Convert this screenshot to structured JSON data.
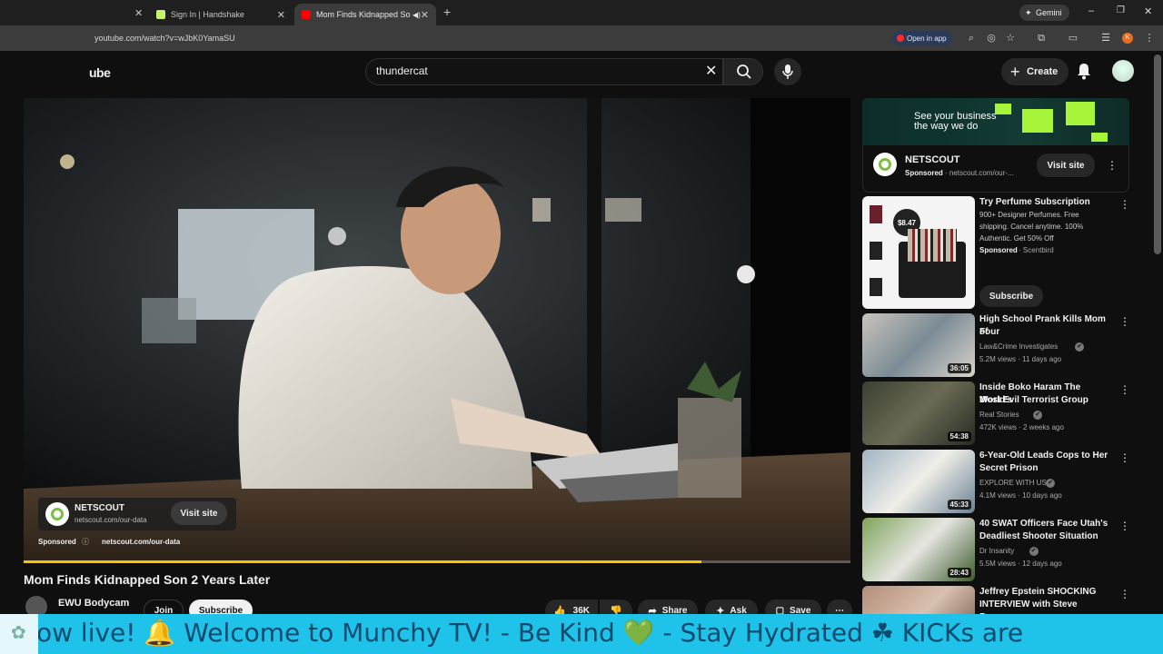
{
  "browser": {
    "tabs": [
      {
        "label": "Sign In | Handshake",
        "favicon_color": "#c7f26b"
      },
      {
        "label": "Mom Finds Kidnapped Son",
        "favicon_color": "#ff0000",
        "active": true
      }
    ],
    "url": "youtube.com/watch?v=wJbK0YamaSU",
    "gemini_label": "Gemini",
    "open_in_app_label": "Open in app"
  },
  "youtube": {
    "logo_text": "ube",
    "search_value": "thundercat",
    "create_label": "Create"
  },
  "player": {
    "progress_fraction": 0.82,
    "ad": {
      "brand": "NETSCOUT",
      "url": "netscout.com/our-data",
      "visit_label": "Visit site",
      "sponsored_label": "Sponsored",
      "sponsored_url": "netscout.com/our-data"
    }
  },
  "video": {
    "title": "Mom Finds Kidnapped Son 2 Years Later",
    "channel": "EWU Bodycam",
    "join_label": "Join",
    "subscribe_label": "Subscribe",
    "likes": "36K",
    "share_label": "Share",
    "ask_label": "Ask",
    "save_label": "Save"
  },
  "sidebar": {
    "ad_banner": {
      "headline_line1": "See your business",
      "headline_line2": "the way we do",
      "brand": "NETSCOUT",
      "sponsored": "Sponsored",
      "url": "· netscout.com/our-...",
      "visit_label": "Visit site"
    },
    "promo": {
      "title": "Try Perfume Subscription",
      "desc_line1": "900+ Designer Perfumes. Free",
      "desc_line2": "shipping. Cancel anytime. 100%",
      "desc_line3": "Authentic. Get 50% Off",
      "sponsored": "Sponsored",
      "advertiser": "· Scentbird",
      "subscribe_label": "Subscribe",
      "price_badge": "$8.47"
    },
    "videos": [
      {
        "title_line1": "High School Prank Kills Mom of",
        "title_line2": "Four",
        "channel": "Law&Crime Investigates",
        "meta": "5.2M views · 11 days ago",
        "duration": "36:05"
      },
      {
        "title_line1": "Inside Boko Haram The World's",
        "title_line2": "Most Evil Terrorist Group",
        "channel": "Real Stories",
        "meta": "472K views · 2 weeks ago",
        "duration": "54:38"
      },
      {
        "title_line1": "6-Year-Old Leads Cops to Her",
        "title_line2": "Secret Prison",
        "channel": "EXPLORE WITH US",
        "meta": "4.1M views · 10 days ago",
        "duration": "45:33"
      },
      {
        "title_line1": "40 SWAT Officers Face Utah's",
        "title_line2": "Deadliest Shooter Situation",
        "channel": "Dr Insanity",
        "meta": "5.5M views · 12 days ago",
        "duration": "28:43"
      },
      {
        "title_line1": "Jeffrey Epstein SHOCKING",
        "title_line2": "INTERVIEW with Steve Bannon...",
        "channel": "",
        "meta": "",
        "duration": ""
      }
    ]
  },
  "ticker": {
    "text": "ow live! 🔔       Welcome to Munchy TV!  - Be Kind 💚  - Stay Hydrated ☘  KICKs are"
  }
}
